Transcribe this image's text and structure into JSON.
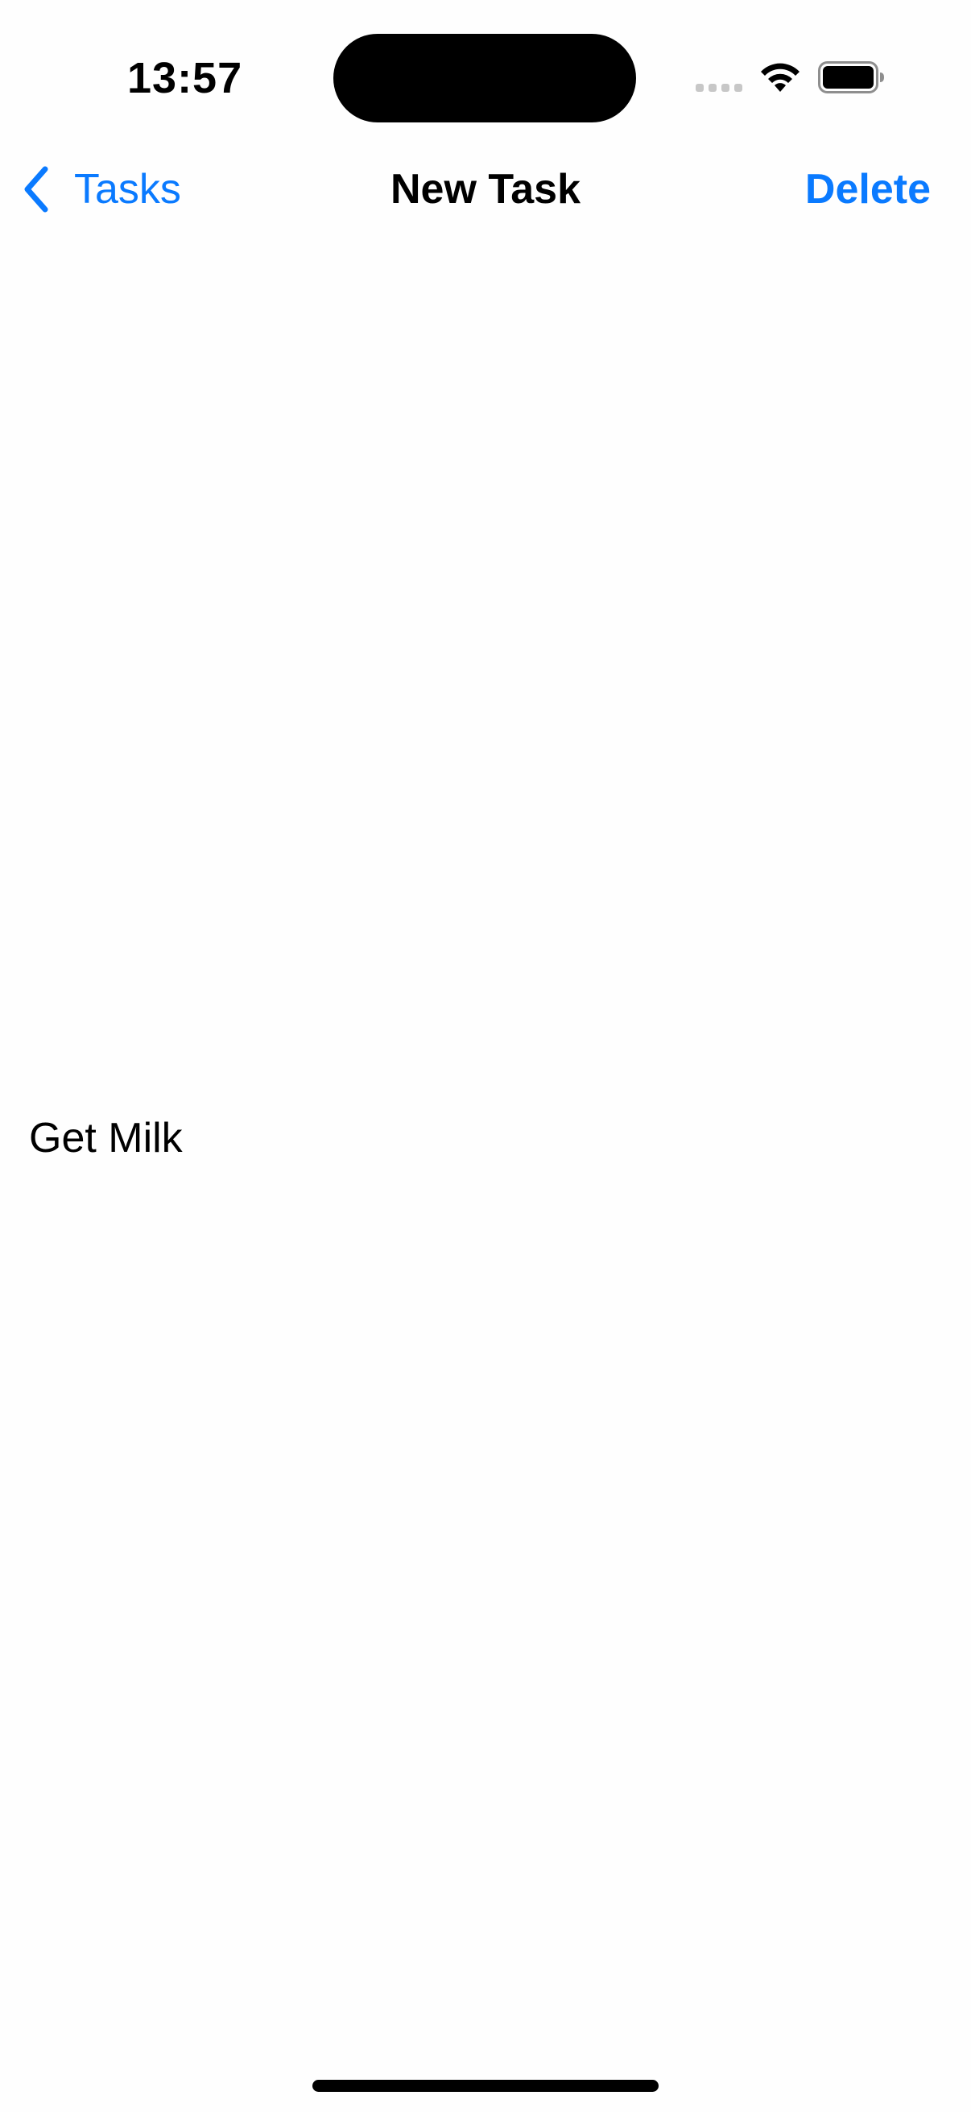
{
  "status_bar": {
    "time": "13:57",
    "icons": [
      "cellular-signal-icon",
      "wifi-icon",
      "battery-icon"
    ]
  },
  "nav": {
    "back_label": "Tasks",
    "title": "New Task",
    "delete_label": "Delete"
  },
  "task": {
    "name": "Get Milk"
  },
  "colors": {
    "accent": "#0a7aff",
    "text": "#000000",
    "background": "#fefefe"
  }
}
